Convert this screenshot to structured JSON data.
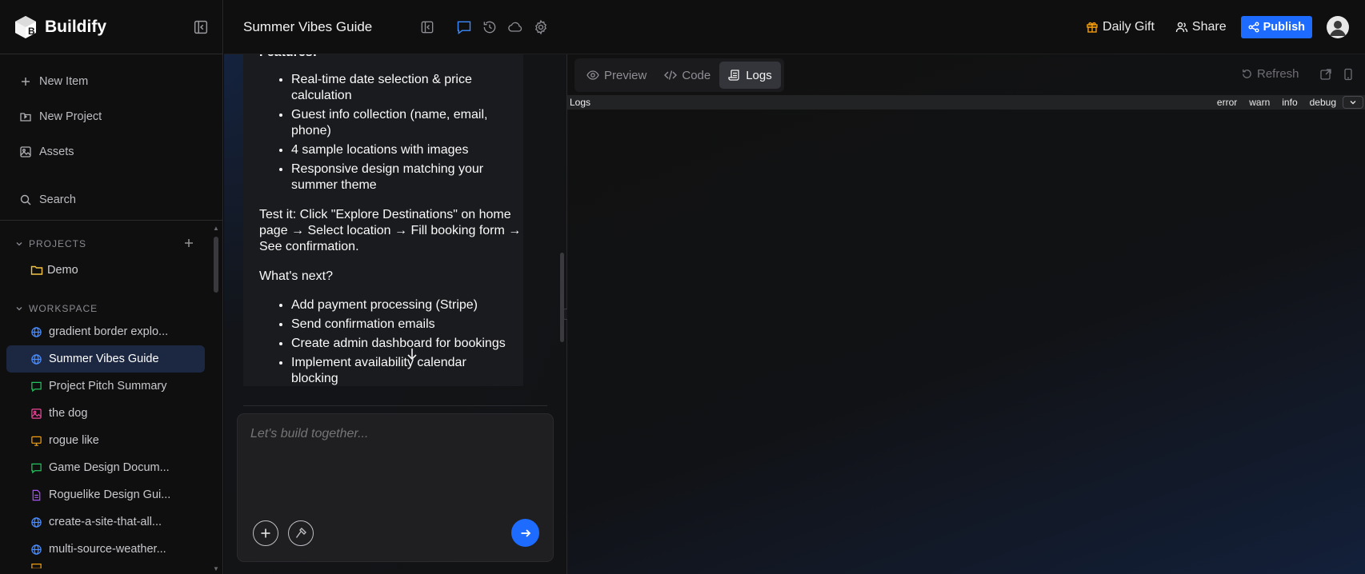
{
  "app": {
    "name": "Buildify"
  },
  "sidebar": {
    "nav": [
      {
        "label": "New Item",
        "icon": "plus-icon"
      },
      {
        "label": "New Project",
        "icon": "folder-plus-icon"
      },
      {
        "label": "Assets",
        "icon": "image-icon"
      }
    ],
    "search_label": "Search",
    "projects_header": "PROJECTS",
    "projects": [
      {
        "label": "Demo",
        "icon": "folder-icon",
        "color": "#f5c542"
      }
    ],
    "workspace_header": "WORKSPACE",
    "workspace": [
      {
        "label": "gradient border explo...",
        "icon": "globe-icon",
        "color": "#4a8dff"
      },
      {
        "label": "Summer Vibes Guide",
        "icon": "globe-icon",
        "color": "#4a8dff",
        "active": true
      },
      {
        "label": "Project Pitch Summary",
        "icon": "chat-icon",
        "color": "#22c55e"
      },
      {
        "label": "the dog",
        "icon": "image-icon",
        "color": "#ec4899"
      },
      {
        "label": "rogue like",
        "icon": "presentation-icon",
        "color": "#f59e0b"
      },
      {
        "label": "Game Design Docum...",
        "icon": "chat-icon",
        "color": "#22c55e"
      },
      {
        "label": "Roguelike Design Gui...",
        "icon": "document-icon",
        "color": "#a855f7"
      },
      {
        "label": "create-a-site-that-all...",
        "icon": "globe-icon",
        "color": "#4a8dff"
      },
      {
        "label": "multi-source-weather...",
        "icon": "globe-icon",
        "color": "#4a8dff"
      }
    ]
  },
  "topbar": {
    "title": "Summer Vibes Guide",
    "daily_gift": "Daily Gift",
    "share": "Share",
    "publish": "Publish"
  },
  "chat": {
    "features_heading": "Features:",
    "features": [
      "Real-time date selection & price calculation",
      "Guest info collection (name, email, phone)",
      "4 sample locations with images",
      "Responsive design matching your summer theme"
    ],
    "test_text": "Test it: Click \"Explore Destinations\" on home page → Select location → Fill booking form → See confirmation.",
    "next_heading": "What's next?",
    "next_items": [
      "Add payment processing (Stripe)",
      "Send confirmation emails",
      "Create admin dashboard for bookings",
      "Implement availability calendar blocking"
    ],
    "composer_placeholder": "Let's build together..."
  },
  "preview": {
    "tabs": [
      {
        "label": "Preview",
        "icon": "eye-icon"
      },
      {
        "label": "Code",
        "icon": "code-icon"
      },
      {
        "label": "Logs",
        "icon": "logs-icon",
        "active": true
      }
    ],
    "refresh": "Refresh",
    "logs_title": "Logs",
    "levels": [
      "error",
      "warn",
      "info",
      "debug"
    ]
  },
  "colors": {
    "accent": "#1d6bff",
    "active_item_bg": "#1c2842",
    "gift": "#f59e0b"
  }
}
